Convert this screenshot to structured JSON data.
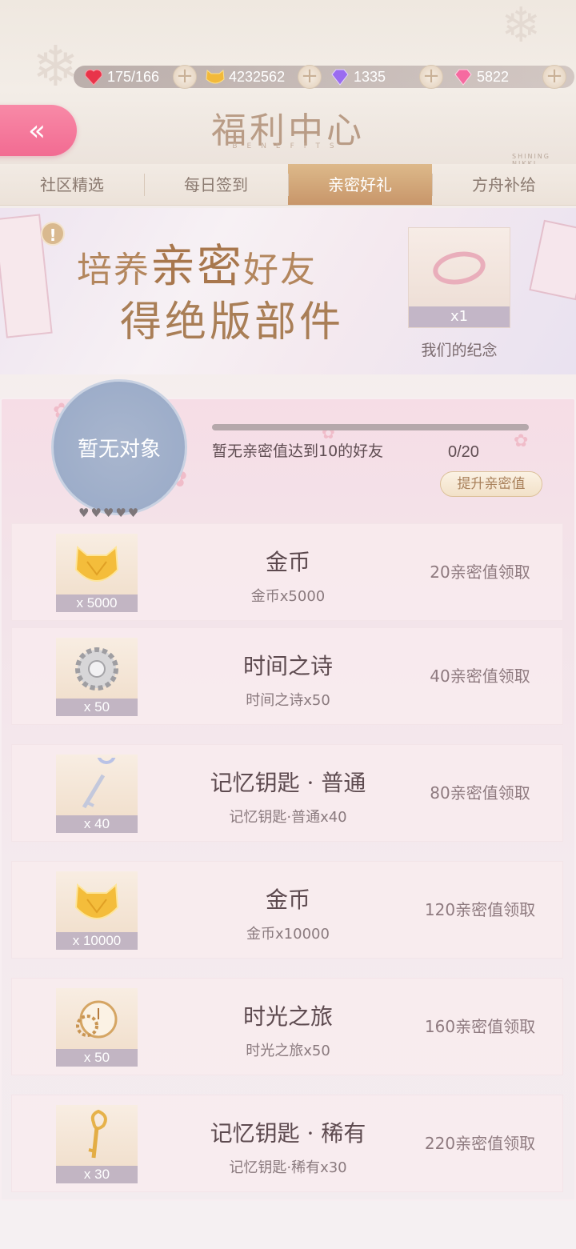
{
  "currencies": [
    {
      "icon": "heart-icon",
      "value": "175/166"
    },
    {
      "icon": "cat-coin-icon",
      "value": "4232562"
    },
    {
      "icon": "purple-diamond-icon",
      "value": "1335"
    },
    {
      "icon": "pink-diamond-icon",
      "value": "5822"
    }
  ],
  "header": {
    "title": "福利中心",
    "subtitle": "BENEFITS",
    "brand": "SHINING NIKKI"
  },
  "tabs": [
    {
      "label": "社区精选",
      "active": false
    },
    {
      "label": "每日签到",
      "active": false
    },
    {
      "label": "亲密好礼",
      "active": true
    },
    {
      "label": "方舟补给",
      "active": false
    }
  ],
  "banner": {
    "line1_a": "培养",
    "line1_b": "亲密",
    "line1_c": "好友",
    "line2": "得绝版部件",
    "reward_qty": "x1",
    "reward_name": "我们的纪念"
  },
  "friend": {
    "avatar_text": "暂无对象",
    "status_text": "暂无亲密值达到10的好友",
    "progress": "0/20",
    "progress_fraction": 0,
    "boost_label": "提升亲密值"
  },
  "rewards": [
    {
      "qty": "x 5000",
      "name": "金币",
      "desc": "金币x5000",
      "claim": "20亲密值领取",
      "icon": "gold-coin-icon"
    },
    {
      "qty": "x 50",
      "name": "时间之诗",
      "desc": "时间之诗x50",
      "claim": "40亲密值领取",
      "icon": "silver-gear-icon"
    },
    {
      "qty": "x 40",
      "name": "记忆钥匙 · 普通",
      "desc": "记忆钥匙·普通x40",
      "claim": "80亲密值领取",
      "icon": "silver-key-icon"
    },
    {
      "qty": "x 10000",
      "name": "金币",
      "desc": "金币x10000",
      "claim": "120亲密值领取",
      "icon": "gold-coin-icon"
    },
    {
      "qty": "x 50",
      "name": "时光之旅",
      "desc": "时光之旅x50",
      "claim": "160亲密值领取",
      "icon": "gold-clock-icon"
    },
    {
      "qty": "x 30",
      "name": "记忆钥匙 · 稀有",
      "desc": "记忆钥匙·稀有x30",
      "claim": "220亲密值领取",
      "icon": "gold-key-icon"
    }
  ]
}
